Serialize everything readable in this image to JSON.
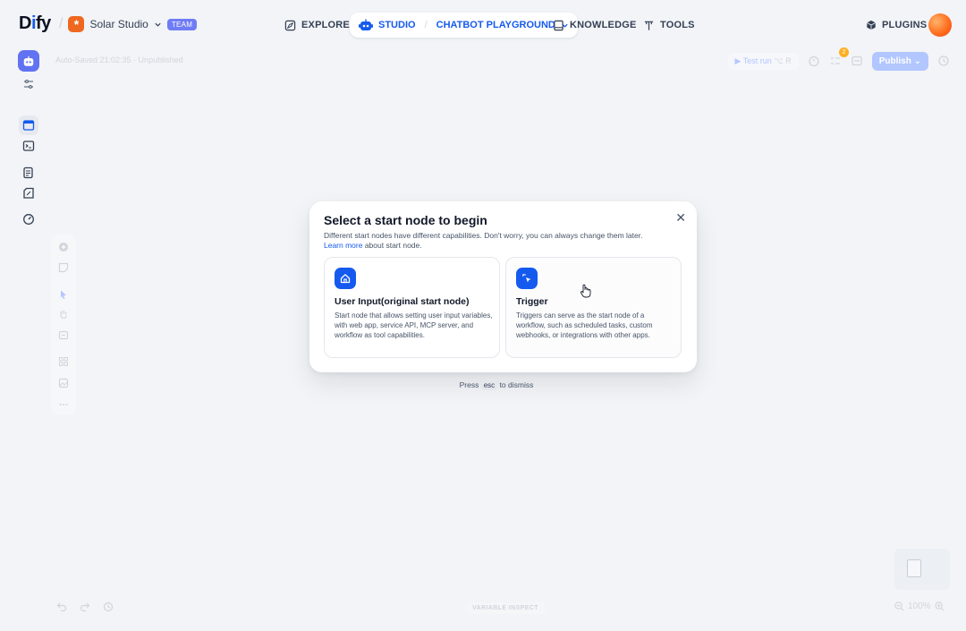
{
  "brand": {
    "logo_text_start": "D",
    "logo_accent": "i",
    "logo_text_end": "fy"
  },
  "workspace": {
    "name": "Solar Studio",
    "badge": "TEAM",
    "icon_glyph": "*"
  },
  "nav": {
    "explore": "EXPLORE",
    "studio": "STUDIO",
    "app_name": "CHATBOT PLAYGROUND",
    "knowledge": "KNOWLEDGE",
    "tools": "TOOLS",
    "plugins": "PLUGINS"
  },
  "editor": {
    "autosave": "Auto-Saved 21:02:35 · Unpublished",
    "test_run": "Test run",
    "test_run_shortcut": "⌥ R",
    "publish": "Publish",
    "checklist_count": "2",
    "variable_inspect": "VARIABLE INSPECT",
    "zoom": "100%"
  },
  "modal": {
    "title": "Select a start node to begin",
    "description": "Different start nodes have different capabilities. Don't worry, you can always change them later.",
    "learn_more": "Learn more",
    "learn_more_suffix": " about start node.",
    "options": [
      {
        "title": "User Input(original start node)",
        "description": "Start node that allows setting user input variables, with web app, service API, MCP server, and workflow as tool capabilities.",
        "icon": "home-icon"
      },
      {
        "title": "Trigger",
        "description": "Triggers can serve as the start node of a workflow, such as scheduled tasks, custom webhooks, or integrations with other apps.",
        "icon": "cursor-click-icon"
      }
    ],
    "dismiss_prefix": "Press",
    "dismiss_key": "esc",
    "dismiss_suffix": "to dismiss"
  },
  "colors": {
    "accent": "#155aef",
    "background": "#f2f4f7",
    "workspace_icon": "#ef6820",
    "app_icon": "#6172f3"
  }
}
